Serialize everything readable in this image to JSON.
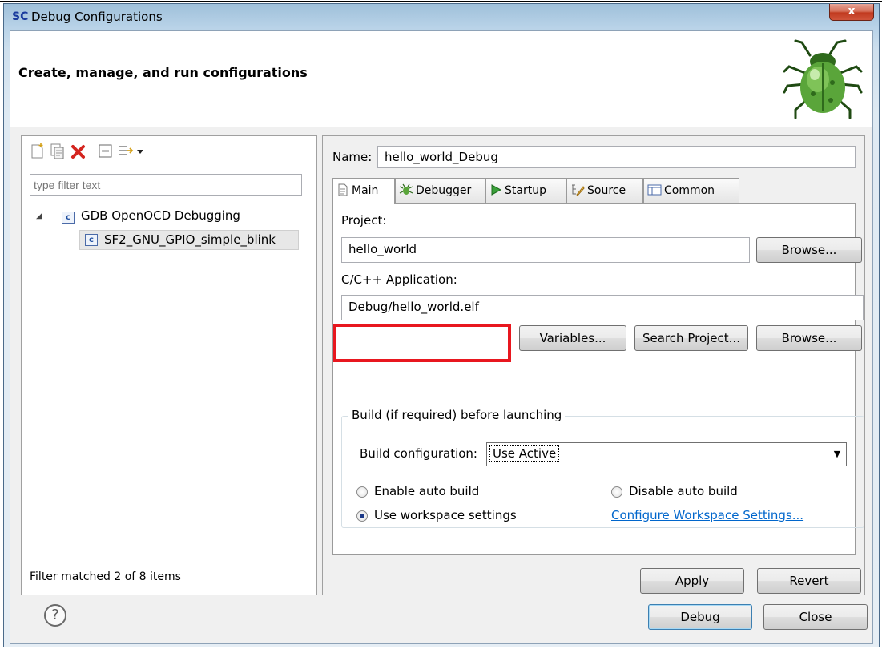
{
  "window": {
    "app_logo": "SC",
    "title": "Debug Configurations",
    "close_glyph": "x"
  },
  "banner": {
    "title": "Create, manage, and run configurations",
    "icon": "bug-icon"
  },
  "left_panel": {
    "toolbar_icons": [
      "new-configuration-icon",
      "duplicate-icon",
      "delete-icon",
      "collapse-all-icon",
      "filter-icon",
      "dropdown-icon"
    ],
    "filter_placeholder": "type filter text",
    "tree": {
      "group_label": "GDB OpenOCD Debugging",
      "child_label": "SF2_GNU_GPIO_simple_blink",
      "node_icon_text": "c"
    },
    "filter_status": "Filter matched 2 of 8 items"
  },
  "right_panel": {
    "name_label": "Name:",
    "name_value": "hello_world_Debug",
    "tabs": [
      {
        "label": "Main",
        "icon": "main-tab-icon",
        "active": true
      },
      {
        "label": "Debugger",
        "icon": "debugger-tab-icon",
        "active": false
      },
      {
        "label": "Startup",
        "icon": "startup-tab-icon",
        "active": false
      },
      {
        "label": "Source",
        "icon": "source-tab-icon",
        "active": false
      },
      {
        "label": "Common",
        "icon": "common-tab-icon",
        "active": false
      }
    ],
    "main": {
      "project_label": "Project:",
      "project_value": "hello_world",
      "browse_label": "Browse...",
      "application_label": "C/C++ Application:",
      "application_value": "Debug/hello_world.elf",
      "variables_label": "Variables...",
      "search_project_label": "Search Project...",
      "browse2_label": "Browse...",
      "build_group_title": "Build (if required) before launching",
      "build_config_label": "Build configuration:",
      "build_config_value": "Use Active",
      "radio_enable": "Enable auto build",
      "radio_disable": "Disable auto build",
      "radio_workspace": "Use workspace settings",
      "configure_link": "Configure Workspace Settings..."
    },
    "apply_label": "Apply",
    "revert_label": "Revert"
  },
  "footer": {
    "help_glyph": "?",
    "debug_label": "Debug",
    "close_label": "Close"
  },
  "colors": {
    "highlight_box": "#e8171f",
    "link": "#0066cc",
    "close_button": "#c13a1f"
  }
}
